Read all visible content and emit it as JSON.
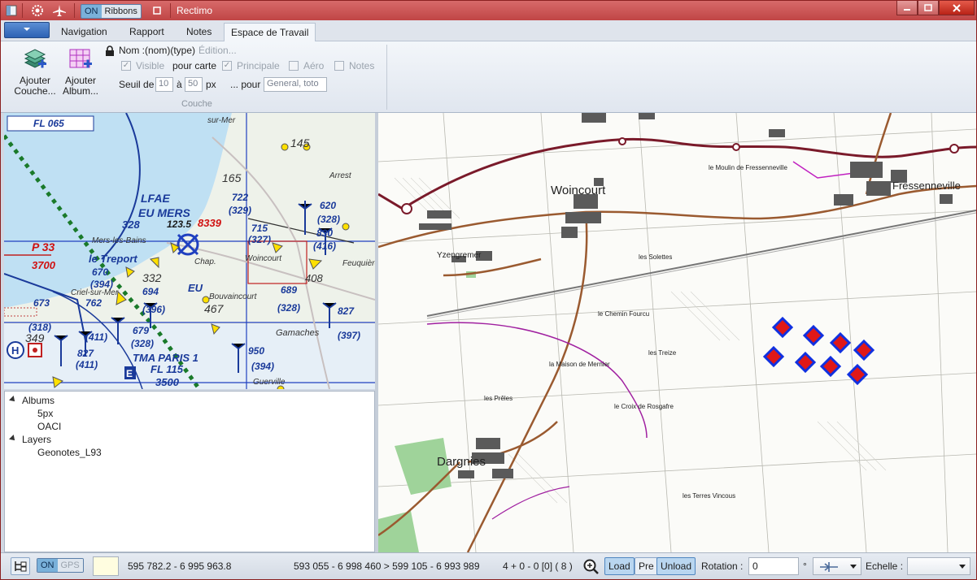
{
  "app": {
    "title": "Rectimo",
    "ribbons_toggle": {
      "on": "ON",
      "label": "Ribbons"
    }
  },
  "tabs": [
    {
      "label": "Navigation"
    },
    {
      "label": "Rapport"
    },
    {
      "label": "Notes"
    },
    {
      "label": "Espace de Travail"
    }
  ],
  "ribbon": {
    "add_layer": "Ajouter Couche...",
    "add_album": "Ajouter Album...",
    "name_label": "Nom :",
    "name_value": "(nom)(type)",
    "name_placeholder": "Édition...",
    "visible_label": "Visible",
    "for_map_label": "pour carte",
    "main_label": "Principale",
    "aero_label": "Aéro",
    "notes_label": "Notes",
    "threshold_label": "Seuil de",
    "threshold_min": "10",
    "to_label": "à",
    "threshold_max": "50",
    "unit_label": "px",
    "for_label": "... pour",
    "for_value": "General, toto",
    "group_label": "Couche"
  },
  "tree": {
    "albums_label": "Albums",
    "albums": [
      "5px",
      "OACI"
    ],
    "layers_label": "Layers",
    "layers": [
      "Geonotes_L93"
    ]
  },
  "left_map": {
    "labels": [
      "FL 065",
      "sur-Mer",
      "145",
      "165",
      "Arrest",
      "LFAE",
      "EU MERS",
      "328",
      "123.5",
      "8339",
      "722",
      "(329)",
      "620",
      "(328)",
      "715",
      "(327)",
      "830",
      "(416)",
      "P 33",
      "3700",
      "Mers-les-Bains",
      "le Treport",
      "Chap.",
      "Woincourt",
      "Feuquières-en-V.",
      "670",
      "(394)",
      "332",
      "694",
      "EU",
      "689",
      "(328)",
      "408",
      "Criel-sur-Mer",
      "762",
      "673",
      "(396)",
      "467",
      "Bouvaincourt",
      "827",
      "(318)",
      "349",
      "(411)",
      "679",
      "(328)",
      "Gamaches",
      "(397)",
      "827",
      "(411)",
      "TMA PARIS 1",
      "FL 115",
      "950",
      "(394)",
      "3500",
      "Guerville",
      "E",
      "H"
    ]
  },
  "right_map": {
    "towns": [
      "Woincourt",
      "Fressenneville",
      "Yzengremer",
      "Dargnies"
    ],
    "places": [
      "le Moulin de Fressenneville",
      "les Solettes",
      "le Chemin Fourcu",
      "les Treize",
      "les Prêles",
      "la Maison de Mernier",
      "le Croix de Rosgafre",
      "les Terres Vincous"
    ]
  },
  "status": {
    "gps_on": "ON",
    "gps_label": "GPS",
    "coords": "595 782.2 - 6 995 963.8",
    "extent": "593 055 - 6 998 460 > 599 105 - 6 993 989",
    "counts": "4 + 0 - 0 [0] ( 8 )",
    "load": "Load",
    "pre": "Pre",
    "unload": "Unload",
    "rotation_label": "Rotation :",
    "rotation_value": "0",
    "degree": "°",
    "scale_label": "Echelle :",
    "scale_value": ""
  },
  "colors": {
    "titlebar": "#c84848",
    "accent": "#4f86c0",
    "marker_fill": "#e01818",
    "marker_border": "#1030e0"
  }
}
